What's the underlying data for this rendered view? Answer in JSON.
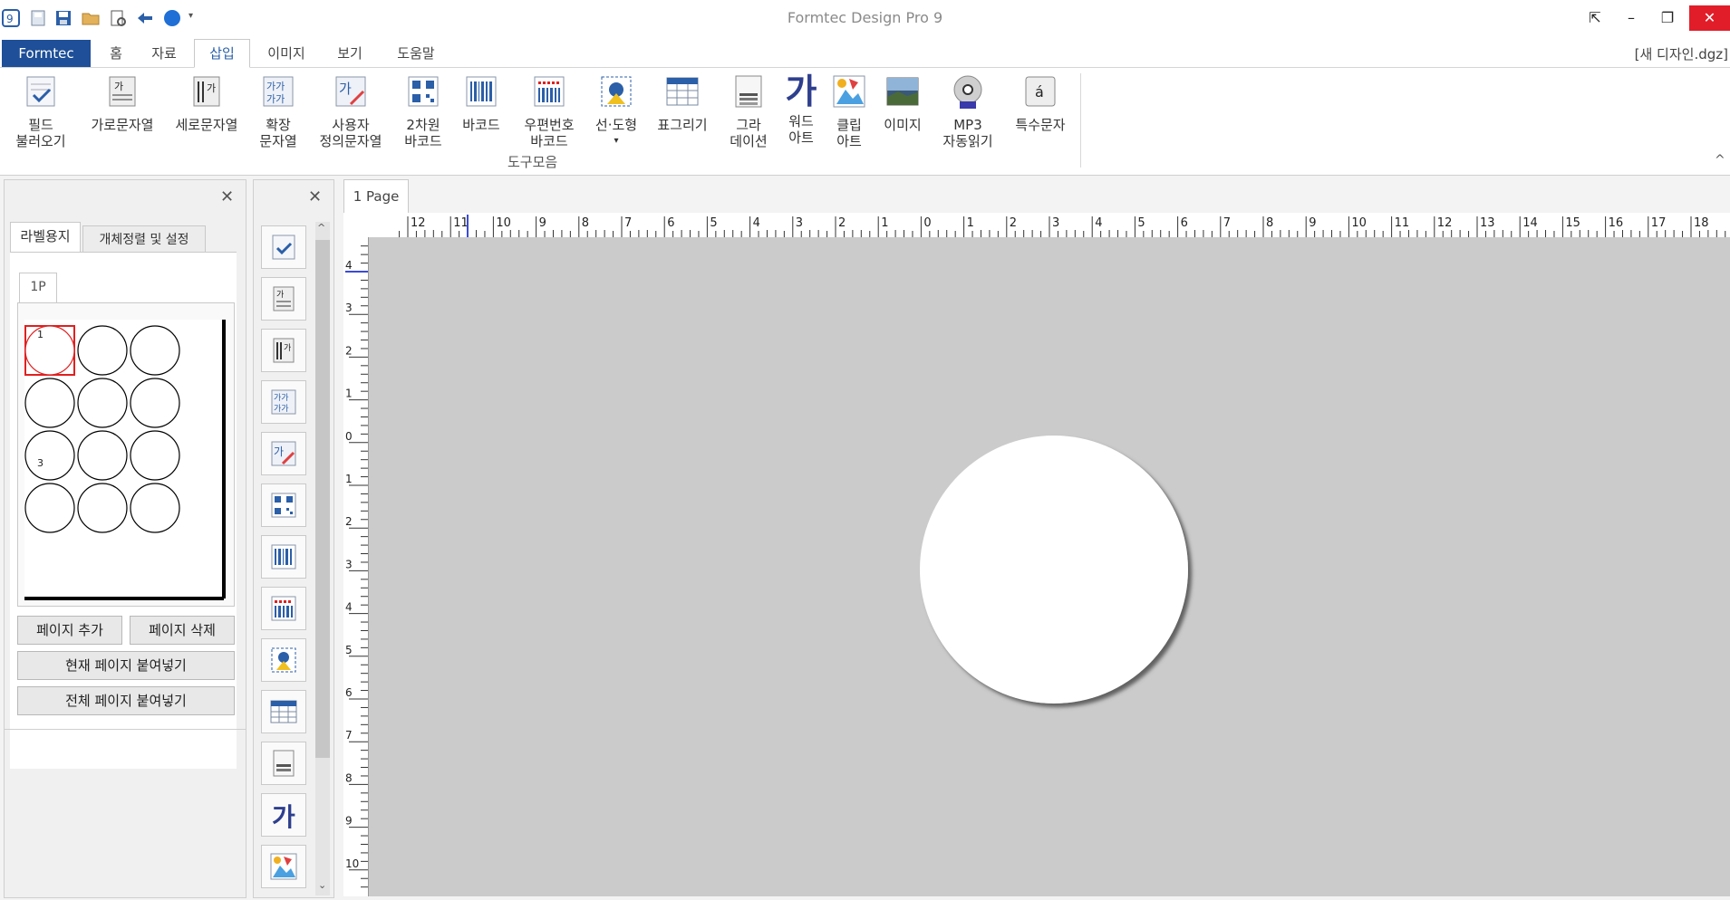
{
  "app": {
    "title": "Formtec Design Pro 9",
    "document_name": "[새 디자인.dgz]"
  },
  "ribbon_tabs": [
    {
      "label": "Formtec"
    },
    {
      "label": "홈"
    },
    {
      "label": "자료"
    },
    {
      "label": "삽입",
      "active": true
    },
    {
      "label": "이미지"
    },
    {
      "label": "보기"
    },
    {
      "label": "도움말"
    }
  ],
  "ribbon": {
    "group_label": "도구모음",
    "buttons": [
      {
        "line1": "필드",
        "line2": "불러오기",
        "icon": "field-load-icon"
      },
      {
        "line1": "가로문자열",
        "line2": "",
        "icon": "horizontal-text-icon"
      },
      {
        "line1": "세로문자열",
        "line2": "",
        "icon": "vertical-text-icon"
      },
      {
        "line1": "확장",
        "line2": "문자열",
        "icon": "extended-text-icon"
      },
      {
        "line1": "사용자",
        "line2": "정의문자열",
        "icon": "custom-text-icon"
      },
      {
        "line1": "2차원",
        "line2": "바코드",
        "icon": "qr-code-icon"
      },
      {
        "line1": "바코드",
        "line2": "",
        "icon": "barcode-icon"
      },
      {
        "line1": "우편번호",
        "line2": "바코드",
        "icon": "postal-barcode-icon"
      },
      {
        "line1": "선·도형",
        "line2": "▾",
        "icon": "shape-icon"
      },
      {
        "line1": "표그리기",
        "line2": "",
        "icon": "table-icon"
      },
      {
        "line1": "그라",
        "line2": "데이션",
        "icon": "gradation-icon"
      },
      {
        "line1": "워드",
        "line2": "아트",
        "icon": "wordart-icon"
      },
      {
        "line1": "클립",
        "line2": "아트",
        "icon": "clipart-icon"
      },
      {
        "line1": "이미지",
        "line2": "",
        "icon": "image-icon"
      },
      {
        "line1": "MP3",
        "line2": "자동읽기",
        "icon": "mp3-icon"
      },
      {
        "line1": "특수문자",
        "line2": "",
        "icon": "special-char-icon"
      }
    ]
  },
  "left_panel": {
    "tabs": [
      "라벨용지",
      "개체정렬 및 설정"
    ],
    "page_tab": "1P",
    "label_numbers": [
      "1",
      "3"
    ],
    "grid": {
      "rows": 4,
      "cols": 3,
      "selected": 0
    },
    "buttons": {
      "add_page": "페이지 추가",
      "delete_page": "페이지 삭제",
      "paste_current": "현재 페이지 붙여넣기",
      "paste_all": "전체 페이지 붙여넣기"
    }
  },
  "toolbox": {
    "icons": [
      "field-load-icon",
      "horizontal-text-icon",
      "vertical-text-icon",
      "extended-text-icon",
      "custom-text-icon",
      "qr-code-icon",
      "barcode-icon",
      "postal-barcode-icon",
      "shape-icon",
      "table-icon",
      "gradation-icon",
      "wordart-icon",
      "clipart-icon"
    ]
  },
  "canvas": {
    "page_tab": "1 Page",
    "hruler_labels": [
      "12",
      "11",
      "10",
      "9",
      "8",
      "7",
      "6",
      "5",
      "4",
      "3",
      "2",
      "1",
      "0",
      "1",
      "2",
      "3",
      "4",
      "5",
      "6",
      "7",
      "8",
      "9",
      "10",
      "11",
      "12",
      "13",
      "14",
      "15",
      "16",
      "17",
      "18"
    ],
    "vruler_labels": [
      "4",
      "3",
      "2",
      "1",
      "0",
      "1",
      "2",
      "3",
      "4",
      "5",
      "6",
      "7",
      "8",
      "9",
      "10"
    ]
  },
  "colors": {
    "accent": "#1e4f98",
    "selected_label": "#e02020",
    "canvas_bg": "#cbcbcb"
  }
}
